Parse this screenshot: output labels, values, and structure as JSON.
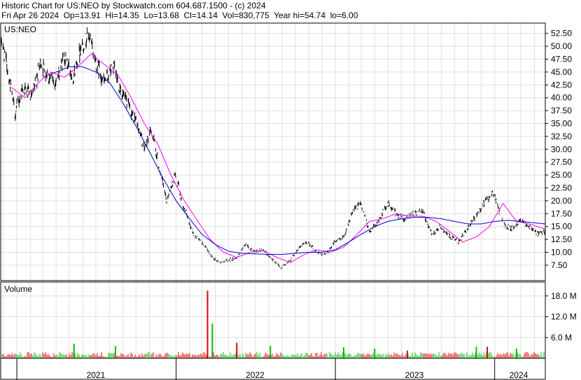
{
  "header": {
    "line1": "Historic Chart for US:NEO by Stockwatch.com 604.687.1500 - (c) 2024",
    "line2": "Fri Apr 26 2024  Op=13.91  Hi=14.35  Lo=13.68  Cl=14.14  Vol=830,775  Year hi=54.74  lo=6.00"
  },
  "colors": {
    "price": "#000000",
    "ma_short": "#ff00ff",
    "ma_long": "#0000cc",
    "vol_up": "#00bb00",
    "vol_down": "#dd0000",
    "grid": "#e0e0e0"
  },
  "chart_data": [
    {
      "type": "line",
      "title": "US:NEO",
      "yticks": [
        "7.50",
        "10.00",
        "12.50",
        "15.00",
        "17.50",
        "20.00",
        "22.50",
        "25.00",
        "27.50",
        "30.00",
        "32.50",
        "35.00",
        "37.50",
        "40.00",
        "42.50",
        "45.00",
        "47.50",
        "50.00",
        "52.50"
      ],
      "ylim": [
        4.5,
        54.5
      ],
      "xlim": [
        "2020-11-25",
        "2024-04-26"
      ],
      "grid": true,
      "series": [
        {
          "key": "close",
          "x": [
            "2020-11-25",
            "2020-12-10",
            "2020-12-28",
            "2021-01-15",
            "2021-02-05",
            "2021-02-25",
            "2021-03-15",
            "2021-04-01",
            "2021-04-20",
            "2021-05-10",
            "2021-05-28",
            "2021-06-15",
            "2021-07-01",
            "2021-07-20",
            "2021-08-10",
            "2021-08-25",
            "2021-09-15",
            "2021-10-05",
            "2021-10-20",
            "2021-11-05",
            "2021-11-22",
            "2021-12-10",
            "2021-12-30",
            "2022-01-20",
            "2022-02-10",
            "2022-03-01",
            "2022-03-20",
            "2022-04-10",
            "2022-05-01",
            "2022-05-20",
            "2022-06-10",
            "2022-06-30",
            "2022-07-20",
            "2022-08-10",
            "2022-08-30",
            "2022-09-20",
            "2022-10-10",
            "2022-10-30",
            "2022-11-20",
            "2022-12-10",
            "2022-12-30",
            "2023-01-20",
            "2023-02-10",
            "2023-03-01",
            "2023-03-20",
            "2023-04-10",
            "2023-05-01",
            "2023-05-20",
            "2023-06-10",
            "2023-06-30",
            "2023-07-20",
            "2023-08-10",
            "2023-08-30",
            "2023-09-20",
            "2023-10-10",
            "2023-10-30",
            "2023-11-20",
            "2023-12-10",
            "2023-12-30",
            "2024-01-20",
            "2024-02-10",
            "2024-03-01",
            "2024-03-20",
            "2024-04-10",
            "2024-04-26"
          ],
          "y": [
            52.0,
            46.0,
            37.0,
            42.0,
            40.0,
            47.0,
            44.0,
            43.0,
            48.0,
            44.0,
            50.0,
            52.0,
            47.0,
            43.0,
            46.0,
            42.0,
            38.0,
            35.0,
            30.0,
            34.0,
            27.0,
            20.0,
            25.0,
            18.5,
            13.5,
            12.0,
            9.5,
            8.0,
            8.5,
            9.0,
            11.5,
            10.0,
            10.5,
            8.5,
            7.0,
            8.5,
            11.0,
            12.0,
            10.0,
            9.5,
            12.0,
            13.0,
            18.0,
            19.5,
            14.0,
            16.0,
            19.5,
            17.5,
            16.5,
            17.5,
            18.0,
            13.5,
            15.0,
            13.0,
            12.0,
            14.5,
            17.0,
            20.0,
            21.5,
            15.5,
            14.5,
            16.5,
            15.0,
            13.5,
            14.14
          ]
        },
        {
          "key": "ma_short",
          "x": [
            "2020-12-20",
            "2021-01-20",
            "2021-02-20",
            "2021-03-20",
            "2021-04-20",
            "2021-05-20",
            "2021-06-20",
            "2021-07-20",
            "2021-08-20",
            "2021-09-20",
            "2021-10-20",
            "2021-11-20",
            "2021-12-20",
            "2022-01-20",
            "2022-02-20",
            "2022-03-20",
            "2022-04-20",
            "2022-05-20",
            "2022-06-20",
            "2022-07-20",
            "2022-08-20",
            "2022-09-20",
            "2022-10-20",
            "2022-11-20",
            "2022-12-20",
            "2023-01-20",
            "2023-02-20",
            "2023-03-20",
            "2023-04-20",
            "2023-05-20",
            "2023-06-20",
            "2023-07-20",
            "2023-08-20",
            "2023-09-20",
            "2023-10-20",
            "2023-11-20",
            "2023-12-20",
            "2024-01-20",
            "2024-02-20",
            "2024-03-20",
            "2024-04-26"
          ],
          "y": [
            42.0,
            40.0,
            43.0,
            45.0,
            44.0,
            46.0,
            48.5,
            46.5,
            44.5,
            40.0,
            35.0,
            31.0,
            25.0,
            20.0,
            16.0,
            12.5,
            10.0,
            9.0,
            10.0,
            10.3,
            9.0,
            8.0,
            9.5,
            10.5,
            10.0,
            11.0,
            13.5,
            16.0,
            16.5,
            17.5,
            17.0,
            17.0,
            16.0,
            14.0,
            12.0,
            13.0,
            15.0,
            19.5,
            16.0,
            15.5,
            14.5
          ]
        },
        {
          "key": "ma_long",
          "x": [
            "2021-03-01",
            "2021-04-01",
            "2021-05-01",
            "2021-06-01",
            "2021-07-01",
            "2021-08-01",
            "2021-09-01",
            "2021-10-01",
            "2021-11-01",
            "2021-12-01",
            "2022-01-01",
            "2022-02-01",
            "2022-03-01",
            "2022-04-01",
            "2022-05-01",
            "2022-06-01",
            "2022-07-01",
            "2022-08-01",
            "2022-09-01",
            "2022-10-01",
            "2022-11-01",
            "2022-12-01",
            "2023-01-01",
            "2023-02-01",
            "2023-03-01",
            "2023-04-01",
            "2023-05-01",
            "2023-06-01",
            "2023-07-01",
            "2023-08-01",
            "2023-09-01",
            "2023-10-01",
            "2023-11-01",
            "2023-12-01",
            "2024-01-01",
            "2024-02-01",
            "2024-03-01",
            "2024-04-26"
          ],
          "y": [
            44.0,
            45.0,
            46.0,
            46.0,
            45.0,
            43.0,
            39.0,
            34.5,
            29.5,
            24.5,
            20.0,
            16.5,
            13.5,
            11.5,
            10.2,
            9.8,
            9.7,
            9.6,
            9.6,
            9.8,
            10.0,
            10.0,
            10.5,
            12.0,
            13.5,
            15.0,
            16.0,
            16.5,
            16.8,
            16.8,
            16.5,
            16.0,
            15.5,
            15.5,
            16.0,
            16.2,
            16.0,
            15.5
          ]
        }
      ]
    },
    {
      "type": "bar",
      "title": "Volume",
      "yticks": [
        "6.0 M",
        "12.0 M",
        "18.0 M"
      ],
      "ylim": [
        0,
        22
      ],
      "notable_bars": [
        {
          "date": "2022-03-14",
          "value": 19.5,
          "dir": "down"
        },
        {
          "date": "2022-03-25",
          "value": 10.0,
          "dir": "up"
        },
        {
          "date": "2021-05-12",
          "value": 4.2,
          "dir": "up"
        },
        {
          "date": "2021-08-15",
          "value": 3.5,
          "dir": "up"
        },
        {
          "date": "2022-05-20",
          "value": 4.5,
          "dir": "down"
        },
        {
          "date": "2022-08-05",
          "value": 3.6,
          "dir": "up"
        },
        {
          "date": "2023-01-20",
          "value": 3.2,
          "dir": "up"
        },
        {
          "date": "2023-04-01",
          "value": 2.8,
          "dir": "up"
        },
        {
          "date": "2023-06-15",
          "value": 2.2,
          "dir": "down"
        },
        {
          "date": "2023-11-20",
          "value": 3.3,
          "dir": "up"
        },
        {
          "date": "2023-12-15",
          "value": 3.3,
          "dir": "down"
        },
        {
          "date": "2024-02-20",
          "value": 2.8,
          "dir": "up"
        }
      ]
    }
  ],
  "x_axis": {
    "labels": [
      {
        "text": "2021",
        "date": "2021-07-01"
      },
      {
        "text": "2022",
        "date": "2022-07-01"
      },
      {
        "text": "2023",
        "date": "2023-07-01"
      },
      {
        "text": "2024",
        "date": "2024-02-25"
      }
    ],
    "boundaries": [
      "2021-01-01",
      "2022-01-01",
      "2023-01-01",
      "2024-01-01"
    ]
  }
}
